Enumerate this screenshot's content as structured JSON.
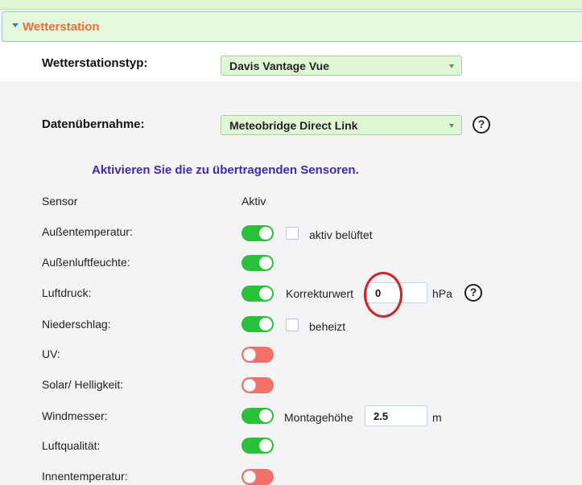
{
  "panel": {
    "title": "Wetterstation"
  },
  "station_type": {
    "label": "Wetterstationstyp:",
    "value": "Davis Vantage Vue"
  },
  "data_import": {
    "label": "Datenübernahme:",
    "value": "Meteobridge Direct Link",
    "help": "?"
  },
  "instruction": "Aktivieren Sie die zu übertragenden Sensoren.",
  "columns": {
    "sensor": "Sensor",
    "active": "Aktiv"
  },
  "sensors": [
    {
      "label": "Außentemperatur:",
      "active": true,
      "extra_checkbox_label": "aktiv belüftet"
    },
    {
      "label": "Außenluftfeuchte:",
      "active": true
    },
    {
      "label": "Luftdruck:",
      "active": true,
      "extra_label": "Korrekturwert",
      "extra_value": "0",
      "extra_unit": "hPa",
      "help": "?"
    },
    {
      "label": "Niederschlag:",
      "active": true,
      "extra_checkbox_label": "beheizt"
    },
    {
      "label": "UV:",
      "active": false
    },
    {
      "label": "Solar/ Helligkeit:",
      "active": false
    },
    {
      "label": "Windmesser:",
      "active": true,
      "extra_label": "Montagehöhe",
      "extra_value": "2.5",
      "extra_unit": "m"
    },
    {
      "label": "Luftqualität:",
      "active": true
    },
    {
      "label": "Innentemperatur:",
      "active": false
    }
  ],
  "colors": {
    "toggle_on": "#28c23a",
    "toggle_off": "#f2706a",
    "panel_title": "#f06b3c",
    "instruction": "#3d2ab8",
    "annotation": "#d1232a"
  }
}
